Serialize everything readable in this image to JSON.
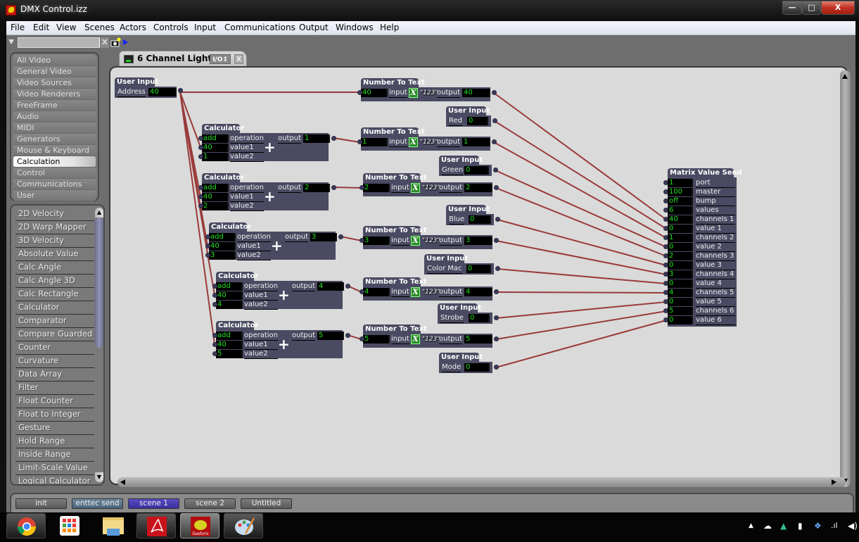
{
  "window": {
    "title": "DMX Control.izz",
    "minimize": "—",
    "maximize": "□",
    "close": "X"
  },
  "menu": [
    "File",
    "Edit",
    "View",
    "Scenes",
    "Actors",
    "Controls",
    "Input",
    "Communications",
    "Output",
    "Windows",
    "Help"
  ],
  "sidebar": {
    "search_value": "",
    "search_clear": "X",
    "categories": [
      {
        "label": "All Video",
        "selected": false
      },
      {
        "label": "General Video",
        "selected": false
      },
      {
        "label": "Video Sources",
        "selected": false
      },
      {
        "label": "Video Renderers",
        "selected": false
      },
      {
        "label": "FreeFrame",
        "selected": false
      },
      {
        "label": "Audio",
        "selected": false
      },
      {
        "label": "MIDI",
        "selected": false
      },
      {
        "label": "Generators",
        "selected": false
      },
      {
        "label": "Mouse & Keyboard",
        "selected": false
      },
      {
        "label": "Calculation",
        "selected": true
      },
      {
        "label": "Control",
        "selected": false
      },
      {
        "label": "Communications",
        "selected": false
      },
      {
        "label": "User",
        "selected": false
      }
    ],
    "actors": [
      "2D Velocity",
      "2D Warp Mapper",
      "3D Velocity",
      "Absolute Value",
      "Calc Angle",
      "Calc Angle 3D",
      "Calc Rectangle",
      "Calculator",
      "Comparator",
      "Compare Guarded",
      "Counter",
      "Curvature",
      "Data Array",
      "Filter",
      "Float Counter",
      "Float to Integer",
      "Gesture",
      "Hold Range",
      "Inside Range",
      "Limit-Scale Value",
      "Logical Calculator"
    ],
    "scroll_up": "▲",
    "scroll_down": "▼"
  },
  "tab": {
    "title": "6 Channel Light",
    "io_label": "I/O↕",
    "close": "X"
  },
  "nodes": {
    "address": {
      "title": "User Input",
      "label": "Address",
      "value": "40"
    },
    "user_inputs": [
      {
        "title": "User Input",
        "label": "Red",
        "value": "0"
      },
      {
        "title": "User Input",
        "label": "Green",
        "value": "0"
      },
      {
        "title": "User Input",
        "label": "Blue",
        "value": "0"
      },
      {
        "title": "User Input",
        "label": "Color Mac",
        "value": "0"
      },
      {
        "title": "User Input",
        "label": "Strobe",
        "value": "0"
      },
      {
        "title": "User Input",
        "label": "Mode",
        "value": "0"
      }
    ],
    "calculators": [
      {
        "title": "Calculator",
        "operation": "add",
        "value1": "40",
        "value2": "1",
        "output": "1"
      },
      {
        "title": "Calculator",
        "operation": "add",
        "value1": "40",
        "value2": "2",
        "output": "2"
      },
      {
        "title": "Calculator",
        "operation": "add",
        "value1": "40",
        "value2": "3",
        "output": "3"
      },
      {
        "title": "Calculator",
        "operation": "add",
        "value1": "40",
        "value2": "4",
        "output": "4"
      },
      {
        "title": "Calculator",
        "operation": "add",
        "value1": "40",
        "value2": "5",
        "output": "5"
      }
    ],
    "calc_labels": {
      "operation": "operation",
      "value1": "value1",
      "value2": "value2",
      "output": "output",
      "plus": "+"
    },
    "number_to_text": [
      {
        "title": "Number To Text",
        "input": "40",
        "output": "40"
      },
      {
        "title": "Number To Text",
        "input": "1",
        "output": "1"
      },
      {
        "title": "Number To Text",
        "input": "2",
        "output": "2"
      },
      {
        "title": "Number To Text",
        "input": "3",
        "output": "3"
      },
      {
        "title": "Number To Text",
        "input": "4",
        "output": "4"
      },
      {
        "title": "Number To Text",
        "input": "5",
        "output": "5"
      }
    ],
    "ntt_labels": {
      "input": "input",
      "output": "output",
      "x": "X",
      "format": "\"123\""
    },
    "matrix": {
      "title": "Matrix Value Send",
      "rows": [
        {
          "value": "1",
          "label": "port"
        },
        {
          "value": "100",
          "label": "master"
        },
        {
          "value": "off",
          "label": "bump"
        },
        {
          "value": "6",
          "label": "values"
        },
        {
          "value": "40",
          "label": "channels 1"
        },
        {
          "value": "0",
          "label": "value 1"
        },
        {
          "value": "1",
          "label": "channels 2"
        },
        {
          "value": "0",
          "label": "value 2"
        },
        {
          "value": "2",
          "label": "channels 3"
        },
        {
          "value": "0",
          "label": "value 3"
        },
        {
          "value": "3",
          "label": "channels 4"
        },
        {
          "value": "0",
          "label": "value 4"
        },
        {
          "value": "4",
          "label": "channels 5"
        },
        {
          "value": "0",
          "label": "value 5"
        },
        {
          "value": "5",
          "label": "channels 6"
        },
        {
          "value": "0",
          "label": "value 6"
        }
      ]
    },
    "wire_color": "#9a3a3a"
  },
  "scenes": [
    {
      "label": "init",
      "state": "normal"
    },
    {
      "label": "enttec send",
      "state": "send"
    },
    {
      "label": "scene 1",
      "state": "active"
    },
    {
      "label": "scene 2",
      "state": "normal"
    },
    {
      "label": "Untitled",
      "state": "normal"
    }
  ],
  "taskbar": {
    "apps": [
      "chrome-icon",
      "apps-grid-icon",
      "file-explorer-icon",
      "acrobat-icon",
      "isadora-icon",
      "paint-icon"
    ],
    "tray": [
      "show-hidden-icon",
      "onedrive-icon",
      "google-drive-icon",
      "power-icon",
      "dropbox-icon",
      "signal-icon",
      "volume-icon"
    ]
  }
}
